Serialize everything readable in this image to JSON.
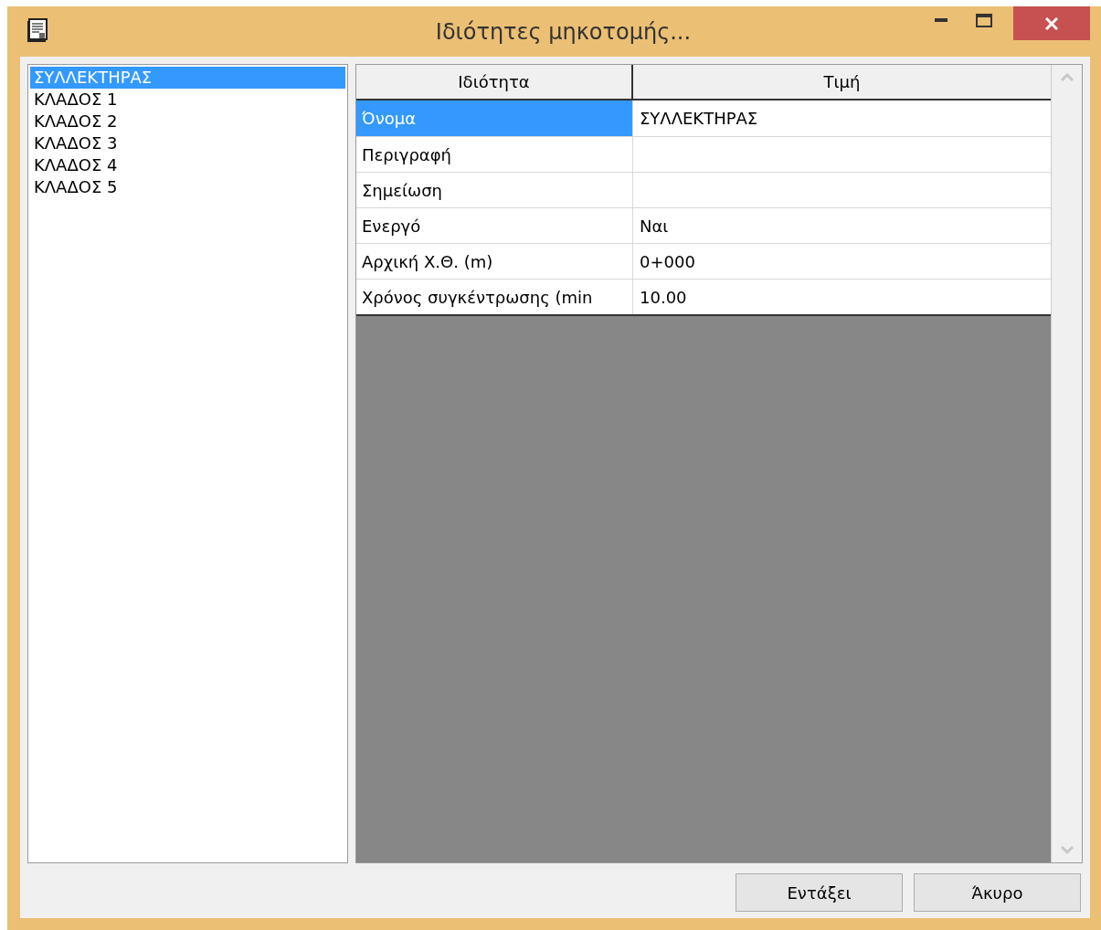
{
  "window": {
    "title": "Ιδιότητες μηκοτομής..."
  },
  "list": {
    "items": [
      {
        "label": "ΣΥΛΛΕΚΤΗΡΑΣ",
        "selected": true
      },
      {
        "label": "ΚΛΑΔΟΣ 1",
        "selected": false
      },
      {
        "label": "ΚΛΑΔΟΣ 2",
        "selected": false
      },
      {
        "label": "ΚΛΑΔΟΣ 3",
        "selected": false
      },
      {
        "label": "ΚΛΑΔΟΣ 4",
        "selected": false
      },
      {
        "label": "ΚΛΑΔΟΣ 5",
        "selected": false
      }
    ]
  },
  "property_grid": {
    "columns": [
      "Ιδιότητα",
      "Τιμή"
    ],
    "rows": [
      {
        "property": "Όνομα",
        "value": "ΣΥΛΛΕΚΤΗΡΑΣ",
        "selected": true
      },
      {
        "property": "Περιγραφή",
        "value": null,
        "selected": false
      },
      {
        "property": "Σημείωση",
        "value": null,
        "selected": false
      },
      {
        "property": "Ενεργό",
        "value": "Ναι",
        "selected": false
      },
      {
        "property": "Αρχική Χ.Θ. (m)",
        "value": "0+000",
        "selected": false
      },
      {
        "property": "Χρόνος συγκέντρωσης (min",
        "value": "10.00",
        "selected": false
      }
    ]
  },
  "buttons": [
    "Εντάξει",
    "Άκυρο"
  ]
}
